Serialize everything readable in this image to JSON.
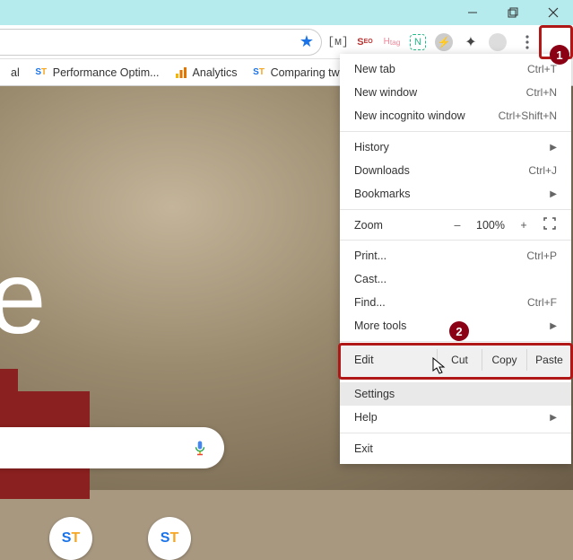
{
  "window": {
    "minimize": "–",
    "maximize": "❐",
    "close": "✕"
  },
  "bookmarks": [
    {
      "label": "al",
      "icon": "generic"
    },
    {
      "label": "Performance Optim...",
      "icon": "st"
    },
    {
      "label": "Analytics",
      "icon": "ga"
    },
    {
      "label": "Comparing two",
      "icon": "st"
    }
  ],
  "menu": {
    "new_tab": {
      "label": "New tab",
      "shortcut": "Ctrl+T"
    },
    "new_window": {
      "label": "New window",
      "shortcut": "Ctrl+N"
    },
    "new_incognito": {
      "label": "New incognito window",
      "shortcut": "Ctrl+Shift+N"
    },
    "history": {
      "label": "History"
    },
    "downloads": {
      "label": "Downloads",
      "shortcut": "Ctrl+J"
    },
    "bookmarks": {
      "label": "Bookmarks"
    },
    "zoom": {
      "label": "Zoom",
      "minus": "–",
      "value": "100%",
      "plus": "+"
    },
    "print": {
      "label": "Print...",
      "shortcut": "Ctrl+P"
    },
    "cast": {
      "label": "Cast..."
    },
    "find": {
      "label": "Find...",
      "shortcut": "Ctrl+F"
    },
    "more_tools": {
      "label": "More tools"
    },
    "edit": {
      "label": "Edit",
      "cut": "Cut",
      "copy": "Copy",
      "paste": "Paste"
    },
    "settings": {
      "label": "Settings"
    },
    "help": {
      "label": "Help"
    },
    "exit": {
      "label": "Exit"
    }
  },
  "page": {
    "logo_fragment": "gle"
  },
  "annotations": {
    "step1": "1",
    "step2": "2"
  }
}
